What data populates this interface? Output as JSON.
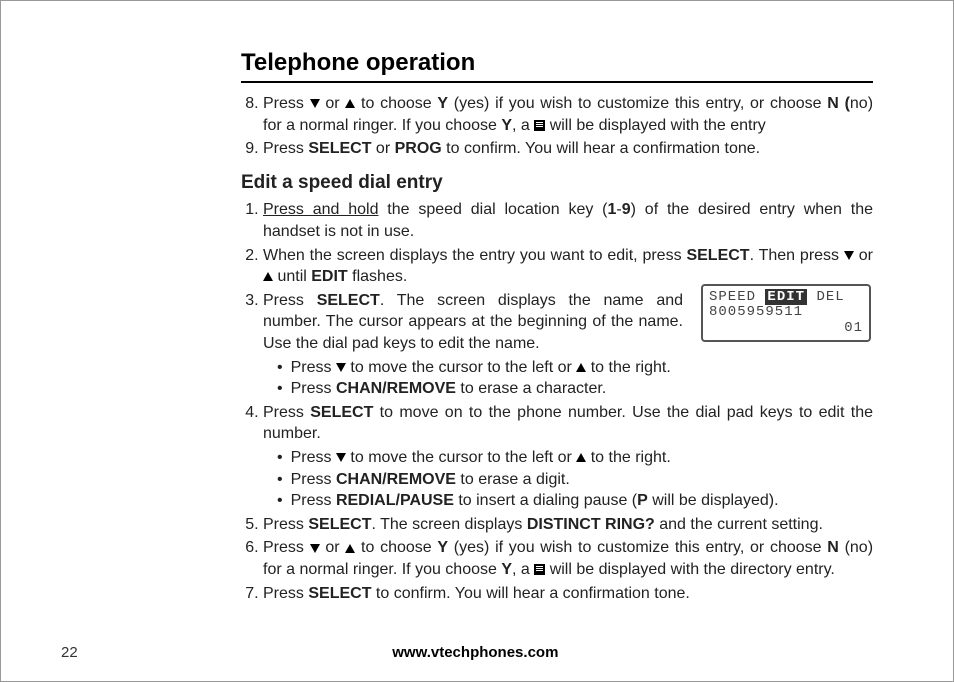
{
  "title": "Telephone operation",
  "section8": {
    "pre": "Press ",
    "mid1": " or ",
    "mid2": " to choose ",
    "y": "Y",
    "mid3": " (yes) if you wish to customize this entry, or choose ",
    "n": "N",
    "mid4": " (",
    "no": "no) for a normal ringer. If you choose ",
    "y2": "Y",
    "mid5": ", a ",
    "tail": " will be displayed with the entry"
  },
  "section9": {
    "pre": "Press ",
    "select": "SELECT",
    "or": " or ",
    "prog": "PROG",
    "tail": " to confirm. You will hear a confirmation tone."
  },
  "subheading": "Edit a speed dial entry",
  "step1": {
    "underlined": "Press and hold",
    "mid": " the speed dial location key (",
    "one": "1",
    "dash": "-",
    "nine": "9",
    "tail": ") of the desired entry when the handset is not in use."
  },
  "step2": {
    "pre": "When the screen displays the entry you want to edit, press ",
    "select": "SELECT",
    "mid1": ". Then press ",
    "mid2": " or ",
    "mid3": " until ",
    "edit": "EDIT",
    "tail": " flashes."
  },
  "step3": {
    "pre": "Press ",
    "select": "SELECT",
    "tail": ". The screen displays the name and number. The cursor appears at the beginning of the name. Use the dial pad keys to edit the name."
  },
  "step3b1": {
    "pre": "Press ",
    "mid": " to move the cursor to the left or ",
    "tail": " to the right."
  },
  "step3b2": {
    "pre": "Press ",
    "chan": "CHAN/REMOVE",
    "tail": " to erase a character."
  },
  "step4": {
    "pre": "Press ",
    "select": "SELECT",
    "tail": " to move on to the phone number. Use the dial pad keys to edit the number."
  },
  "step4b1": {
    "pre": "Press ",
    "mid": " to move the cursor to the left or ",
    "tail": " to the right."
  },
  "step4b2": {
    "pre": "Press ",
    "chan": "CHAN/REMOVE",
    "tail": " to erase a digit."
  },
  "step4b3": {
    "pre": "Press ",
    "redial": "REDIAL/PAUSE",
    "mid": " to insert a dialing pause (",
    "p": "P",
    "tail": " will be displayed)."
  },
  "step5": {
    "pre": "Press ",
    "select": "SELECT",
    "mid": ". The screen displays ",
    "distinct": "DISTINCT RING?",
    "tail": " and the current setting."
  },
  "step6": {
    "pre": "Press ",
    "mid1": " or ",
    "mid2": " to choose ",
    "y": "Y",
    "mid3": " (yes) if you wish to customize this entry, or choose ",
    "n": "N",
    "mid4": " (no) for a normal ringer. If you choose ",
    "y2": "Y",
    "mid5": ", a ",
    "tail": " will be displayed with the directory entry."
  },
  "step7": {
    "pre": "Press ",
    "select": "SELECT",
    "tail": " to confirm. You will hear a confirmation tone."
  },
  "lcd": {
    "speed": "SPEED",
    "edit": "EDIT",
    "del": "DEL",
    "num": "8005959511",
    "idx": "01"
  },
  "footer": {
    "page": "22",
    "url": "www.vtechphones.com"
  }
}
